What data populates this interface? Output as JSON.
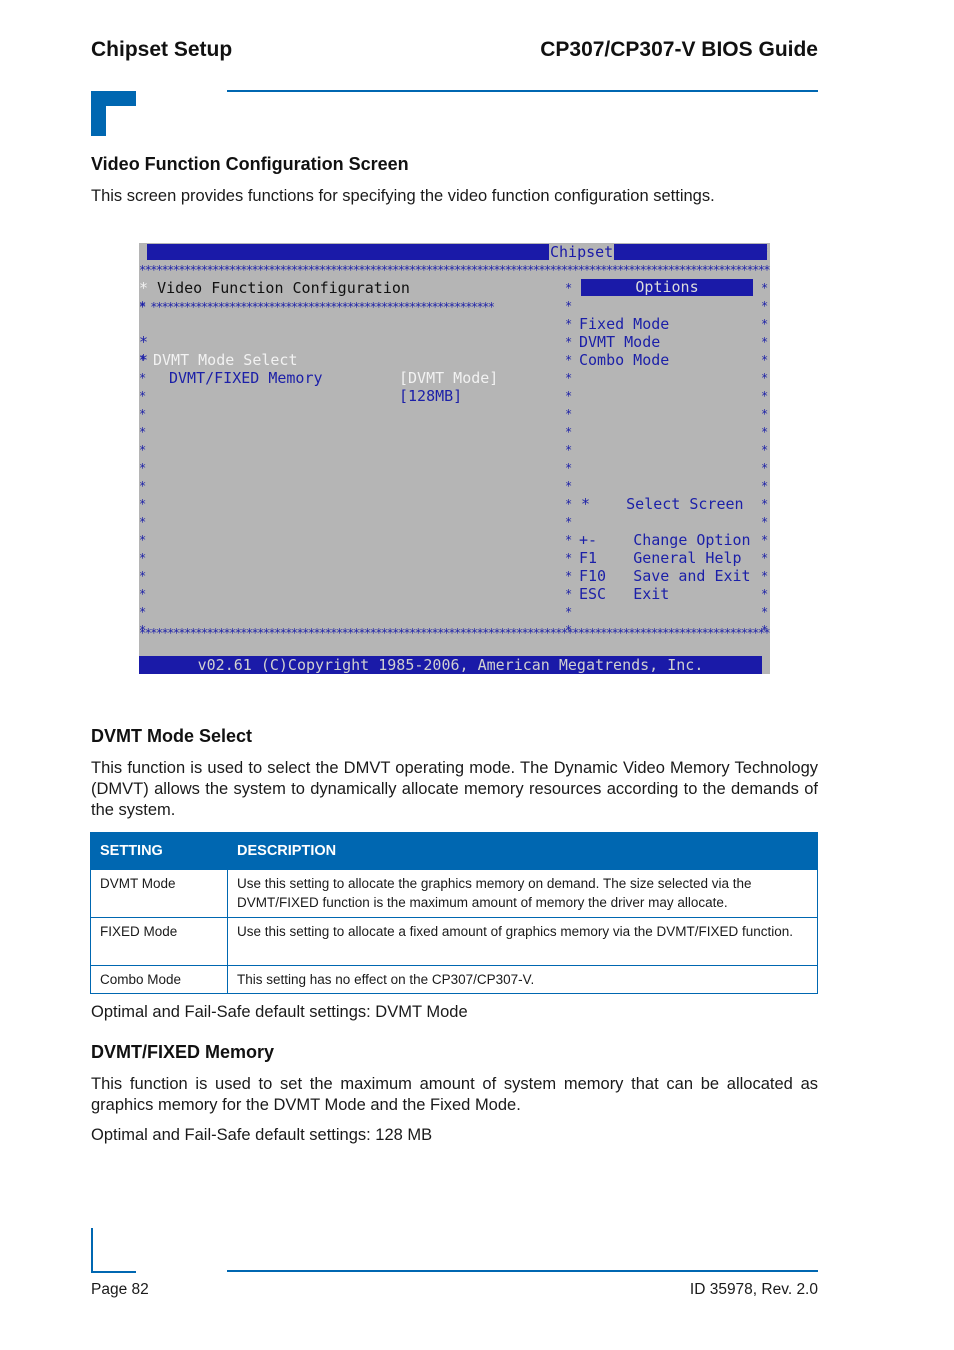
{
  "header": {
    "section": "Chipset Setup",
    "guide_title": "CP307/CP307-V BIOS Guide"
  },
  "video_screen": {
    "heading": "Video Function Configuration Screen",
    "intro": "This screen provides functions for specifying the video function configuration settings."
  },
  "bios": {
    "tab": "Chipset",
    "screen_title": "Video Function Configuration",
    "items": [
      {
        "label": "DVMT Mode Select",
        "value": "[DVMT Mode]"
      },
      {
        "label": "DVMT/FIXED Memory",
        "value": "[128MB]"
      }
    ],
    "options_title": "Options",
    "options": [
      "Fixed Mode",
      "DVMT Mode",
      "Combo Mode"
    ],
    "help": [
      {
        "key": "*",
        "text": "Select Screen"
      },
      {
        "key": "+-",
        "text": "Change Option"
      },
      {
        "key": "F1",
        "text": "General Help"
      },
      {
        "key": "F10",
        "text": "Save and Exit"
      },
      {
        "key": "ESC",
        "text": "Exit"
      }
    ],
    "footer": "v02.61 (C)Copyright 1985-2006, American Megatrends, Inc."
  },
  "dvmt_mode_select": {
    "heading": "DVMT Mode Select",
    "body": "This function is used to select the DMVT operating mode. The Dynamic Video Memory Technology (DMVT) allows the system to dynamically allocate memory resources according to the demands of the system.",
    "table": {
      "headers": [
        "SETTING",
        "DESCRIPTION"
      ],
      "rows": [
        [
          "DVMT Mode",
          "Use this setting to allocate the graphics memory on demand. The size selected via the DVMT/FIXED function is the maximum amount of memory the driver may allocate."
        ],
        [
          "FIXED Mode",
          "Use this setting to allocate a fixed amount of graphics memory via the DVMT/FIXED function."
        ],
        [
          "Combo Mode",
          "This setting has no effect on the CP307/CP307-V."
        ]
      ]
    },
    "defaults": "Optimal and Fail-Safe default settings: DVMT Mode"
  },
  "dvmt_fixed_memory": {
    "heading": "DVMT/FIXED Memory",
    "body": "This function is used to set the maximum amount of system memory that can be allocated as graphics memory for the DVMT Mode and the Fixed Mode.",
    "defaults": "Optimal and Fail-Safe default settings: 128 MB"
  },
  "footer": {
    "page": "Page 82",
    "doc_id": "ID 35978, Rev. 2.0"
  }
}
